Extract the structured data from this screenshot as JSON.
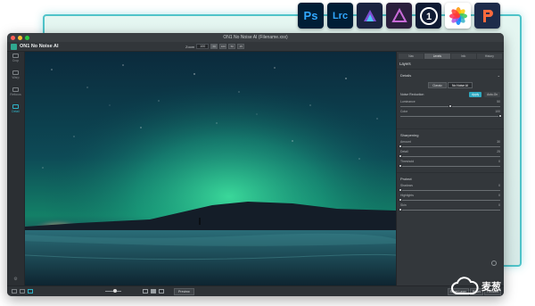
{
  "window": {
    "title": "ON1 No Noise AI (Filename.xxx)",
    "app_name": "ON1 No Noise AI"
  },
  "toolbar": {
    "zoom_label": "Zoom",
    "zoom_value": "100",
    "view_buttons": [
      "Fit",
      "100",
      "50",
      "25"
    ]
  },
  "left_rail": {
    "items": [
      {
        "label": "Crop",
        "icon": "crop-icon"
      },
      {
        "label": "Warp",
        "icon": "warp-icon"
      },
      {
        "label": "Refocus",
        "icon": "refocus-icon"
      },
      {
        "label": "Detail",
        "icon": "detail-icon",
        "active": true
      }
    ]
  },
  "panel": {
    "tabs": [
      "Nav",
      "Levels",
      "Info",
      "History"
    ],
    "active_tab": "Levels",
    "layers_title": "Layers",
    "details_title": "Details",
    "mode_buttons": [
      "Classic",
      "No Noise AI"
    ],
    "noise_reduction": {
      "label": "Noise Reduction",
      "apply_label": "Apply",
      "auto_label": "Auto-On"
    },
    "noise_sliders": [
      {
        "label": "Luminance",
        "value": "50",
        "level": 0.5
      },
      {
        "label": "Color",
        "value": "100",
        "level": 1.0
      }
    ],
    "sharpening_title": "Sharpening",
    "sharpening_sliders": [
      {
        "label": "Amount",
        "value": "30",
        "level": 0.0
      },
      {
        "label": "Detail",
        "value": "25",
        "level": 0.0
      },
      {
        "label": "Threshold",
        "value": "0",
        "level": 0.0
      }
    ],
    "protect_title": "Protect",
    "protect_sliders": [
      {
        "label": "Shadows",
        "value": "0",
        "level": 0.0
      },
      {
        "label": "Highlights",
        "value": "0",
        "level": 0.0
      },
      {
        "label": "Skin",
        "value": "0",
        "level": 0.0
      }
    ]
  },
  "statusbar": {
    "preview_label": "Preview",
    "actions": [
      "Reset Layer",
      "Reset",
      "Previous"
    ]
  },
  "host_apps": [
    {
      "label": "Ps",
      "icon": "photoshop-icon",
      "bg": "#001e36",
      "fg": "#31a8ff"
    },
    {
      "label": "Lrc",
      "icon": "lightroom-classic-icon",
      "bg": "#001e36",
      "fg": "#31a8ff"
    },
    {
      "label": "",
      "icon": "affinity-photo-icon",
      "bg": "#1a2340",
      "fg": "#7e4dd2"
    },
    {
      "label": "",
      "icon": "affinity-icon",
      "bg": "#2b1f3d",
      "fg": "#c86bd8"
    },
    {
      "label": "1",
      "icon": "on1-icon",
      "bg": "#0f1a33",
      "fg": "#ffffff"
    },
    {
      "label": "",
      "icon": "apple-photos-icon",
      "bg": "#ffffff",
      "fg": "#ff9500"
    },
    {
      "label": "",
      "icon": "corel-paintshop-icon",
      "bg": "#1d2b4a",
      "fg": "#ff6a3d"
    }
  ],
  "watermark": {
    "text": "麦葱",
    "icon": "cloud-icon"
  },
  "colors": {
    "accent": "#2fa9c0",
    "frame_glow": "#4fc3c9",
    "panel_bg": "#33373b"
  }
}
